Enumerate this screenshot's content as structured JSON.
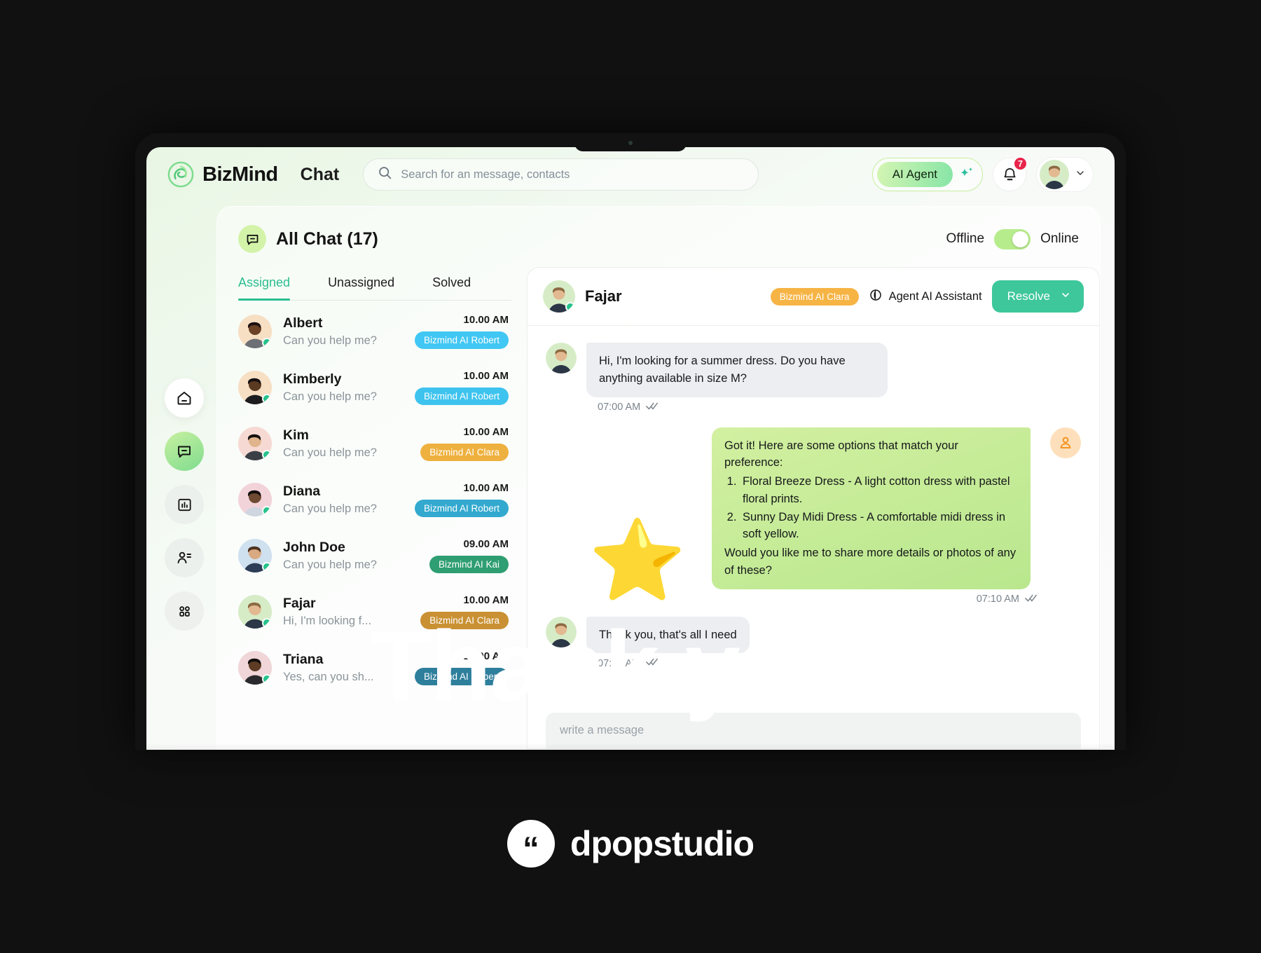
{
  "brand": {
    "name": "BizMind",
    "section": "Chat",
    "logo_icon": "bizmind-swirl-logo"
  },
  "search": {
    "placeholder": "Search for an message, contacts",
    "value": "",
    "icon": "search-icon"
  },
  "topbar": {
    "ai_agent_label": "AI Agent",
    "sparkle_icon": "sparkle-icon",
    "bell_icon": "bell-icon",
    "notification_count": "7",
    "chevron_icon": "chevron-down-icon"
  },
  "rail": [
    {
      "name": "home",
      "icon": "home-icon",
      "active": false
    },
    {
      "name": "chat",
      "icon": "chat-bubble-icon",
      "active": true
    },
    {
      "name": "analytics",
      "icon": "bar-chart-icon",
      "active": false
    },
    {
      "name": "contacts",
      "icon": "person-list-icon",
      "active": false
    },
    {
      "name": "apps",
      "icon": "grid-apps-icon",
      "active": false
    }
  ],
  "panel": {
    "title": "All Chat (17)",
    "title_icon": "chat-bubble-icon",
    "status": {
      "off_label": "Offline",
      "on_label": "Online",
      "is_online": true
    }
  },
  "tabs": [
    {
      "label": "Assigned",
      "active": true
    },
    {
      "label": "Unassigned",
      "active": false
    },
    {
      "label": "Solved",
      "active": false
    }
  ],
  "chats": [
    {
      "name": "Albert",
      "preview": "Can you help me?",
      "time": "10.00 AM",
      "tag": "Bizmind AI Robert",
      "tag_color": "#41c7f4",
      "avatar_bg": "#f7dfc4",
      "skin": "#6b4226",
      "hair": "#1b1110",
      "shirt": "#6c6f75",
      "online": true
    },
    {
      "name": "Kimberly",
      "preview": "Can you help me?",
      "time": "10.00 AM",
      "tag": "Bizmind AI Robert",
      "tag_color": "#3ec3ef",
      "avatar_bg": "#f7dfc4",
      "skin": "#5b3a22",
      "hair": "#141010",
      "shirt": "#1c1c1e",
      "online": true
    },
    {
      "name": "Kim",
      "preview": "Can you help me?",
      "time": "10.00 AM",
      "tag": "Bizmind AI Clara",
      "tag_color": "#eeb13f",
      "avatar_bg": "#f7d9d3",
      "skin": "#e0b48c",
      "hair": "#14110f",
      "shirt": "#3a3f46",
      "online": true
    },
    {
      "name": "Diana",
      "preview": "Can you help me?",
      "time": "10.00 AM",
      "tag": "Bizmind AI Robert",
      "tag_color": "#33a9cf",
      "avatar_bg": "#f3d3da",
      "skin": "#6d4a31",
      "hair": "#120e0d",
      "shirt": "#cfd6e0",
      "online": true
    },
    {
      "name": "John Doe",
      "preview": "Can you help me?",
      "time": "09.00 AM",
      "tag": "Bizmind AI Kai",
      "tag_color": "#2f9e72",
      "avatar_bg": "#cfe0ef",
      "skin": "#d9a982",
      "hair": "#4e3220",
      "shirt": "#2d3d55",
      "online": true
    },
    {
      "name": "Fajar",
      "preview": "Hi, I'm looking f...",
      "time": "10.00 AM",
      "tag": "Bizmind AI Clara",
      "tag_color": "#c99133",
      "avatar_bg": "#d6ecc7",
      "skin": "#e3b992",
      "hair": "#8d6a43",
      "shirt": "#2b3646",
      "online": true
    },
    {
      "name": "Triana",
      "preview": "Yes, can you sh...",
      "time": "10.00 AM",
      "tag": "Bizmind AI Robert",
      "tag_color": "#2e7f9c",
      "avatar_bg": "#f0d6d8",
      "skin": "#5d3b24",
      "hair": "#120d0c",
      "shirt": "#2a2a2e",
      "online": true
    }
  ],
  "conversation": {
    "contact_name": "Fajar",
    "tag": "Bizmind AI Clara",
    "tag_color": "#f6b445",
    "agent_icon": "moon-agent-icon",
    "agent_label": "Agent AI Assistant",
    "resolve_label": "Resolve",
    "resolve_chevron": "chevron-down-icon",
    "messages": [
      {
        "direction": "in",
        "text": "Hi, I'm looking for a summer dress. Do you have anything available in size M?",
        "time": "07:00 AM",
        "status_icon": "double-check-icon"
      },
      {
        "direction": "out",
        "intro": "Got it! Here are some options that match your preference:",
        "items": [
          "Floral Breeze Dress - A light cotton dress with pastel floral prints.",
          "Sunny Day Midi Dress - A comfortable midi dress in soft yellow."
        ],
        "outro": "Would you like me to share more details or photos of any of these?",
        "time": "07:10 AM",
        "status_icon": "double-check-icon",
        "agent_avatar_icon": "person-icon"
      },
      {
        "direction": "in",
        "text": "Thank you, that's all I need",
        "time": "07:00 AM",
        "status_icon": "double-check-icon"
      }
    ],
    "composer_placeholder": "write a message"
  },
  "overlay": {
    "headline": "Thank you!",
    "star_emoji": "⭐",
    "studio_name": "dpopstudio",
    "quote_icon": "quote-mark-icon"
  },
  "colors": {
    "accent_green": "#2bbd91",
    "brand_light_green": "#c8f0a0",
    "badge_red": "#e8254a",
    "bubble_green": "#c9ee9a"
  }
}
